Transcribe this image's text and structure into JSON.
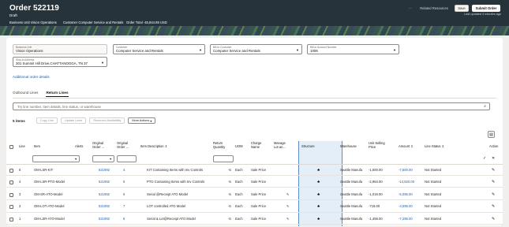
{
  "header": {
    "title": "Order 522119",
    "subtitle": "Draft",
    "business_unit": "Business Unit Vision Operations",
    "customer": "Customer Computer Service and Rentals",
    "order_total": "Order Total -45,844.89 USD",
    "btn_more": "···",
    "btn_related": "Related Resources",
    "btn_save": "Save",
    "btn_submit": "Submit Order",
    "last_updated": "Last updated 3 minutes ago"
  },
  "form": {
    "business_unit": {
      "label": "Business Unit",
      "value": "Vision Operations"
    },
    "customer": {
      "label": "Customer",
      "value": "Computer Service and Rentals"
    },
    "bill_to_customer": {
      "label": "Bill-to Customer",
      "value": "Computer Service and Rentals"
    },
    "bill_to_account": {
      "label": "Bill-to Account Number",
      "value": "1006"
    },
    "ship_to_address": {
      "label": "Ship-to Address",
      "value": "301 Summit Hill Drive,CHATTANOOGA, TN 37"
    },
    "additional_link": "Additional order details"
  },
  "tabs": [
    "Outbound Lines",
    "Return Lines"
  ],
  "search": {
    "placeholder": "Try line number, item details, line status, or warehouse"
  },
  "toolbar": {
    "count": "5 items",
    "copy": "Copy Line",
    "update": "Update Lines",
    "availability": "Reserved Availability",
    "more": "More Actions"
  },
  "columns": {
    "line": "Line",
    "item": "Item",
    "alerts": "Alerts",
    "orig_order1": "Original",
    "orig_order2": "Order ...",
    "orig_line1": "Original",
    "orig_line2": "Order ...",
    "desc": "Item Description",
    "ret_qty1": "Return",
    "ret_qty2": "Quantity",
    "uom": "UOM",
    "charge1": "Charge",
    "charge2": "Name",
    "manage1": "Manage",
    "manage2": "Lot an...",
    "structure": "Structure",
    "warehouse": "Warehouse",
    "price1": "Unit Selling",
    "price2": "Price",
    "amount": "Amount",
    "status": "Line Status",
    "action": "Action"
  },
  "rows": [
    {
      "line": "5",
      "item": "OM-LSR-KIT",
      "orig_order": "521992",
      "orig_line": "4",
      "desc": "KIT Containing Items with Inv Controls",
      "qty": "-5",
      "uom": "Each",
      "charge": "Sale Price",
      "manage": "",
      "warehouse": "Seattle Manufa",
      "price": "-1,500.00",
      "amount": "-7,500.00",
      "status": "Not Started"
    },
    {
      "line": "4",
      "item": "OM-LSR-PTO-Model",
      "orig_order": "521992",
      "orig_line": "5",
      "desc": "PTO Containing Items with Inv Controls",
      "qty": "-5",
      "uom": "Each",
      "charge": "Sale Price",
      "manage": "",
      "warehouse": "Seattle Manufa",
      "price": "-2,964.00",
      "amount": "-14,820.00",
      "status": "Not Started"
    },
    {
      "line": "3",
      "item": "OM-SR-ATO-Model",
      "orig_order": "521992",
      "orig_line": "6",
      "desc": "Serial @Receipt ATO Model",
      "qty": "-5",
      "uom": "Each",
      "charge": "Sale Price",
      "manage": "✎",
      "warehouse": "Seattle Manufa",
      "price": "-1,019.00",
      "amount": "-5,095.00",
      "status": "Not Started"
    },
    {
      "line": "2",
      "item": "OM-LOT-ATO-Model",
      "orig_order": "521992",
      "orig_line": "7",
      "desc": "LOT controlled ATO Model",
      "qty": "-5",
      "uom": "Each",
      "charge": "Sale Price",
      "manage": "✎",
      "warehouse": "Seattle Manufa",
      "price": "-719.00",
      "amount": "-3,595.00",
      "status": "Not Started"
    },
    {
      "line": "1",
      "item": "OM-LSR-ATO-Model",
      "orig_order": "521992",
      "orig_line": "8",
      "desc": "Serial & Lot@Receipt ATO Model",
      "qty": "-5",
      "uom": "Each",
      "charge": "Sale Price",
      "manage": "✎",
      "warehouse": "Seattle Manufa",
      "price": "-1,459.00",
      "amount": "-7,295.00",
      "status": "Not Started"
    }
  ],
  "colors": {
    "header_bg": "#27333a",
    "link": "#1f5fa8",
    "structure_highlight": "#e3eef8"
  }
}
